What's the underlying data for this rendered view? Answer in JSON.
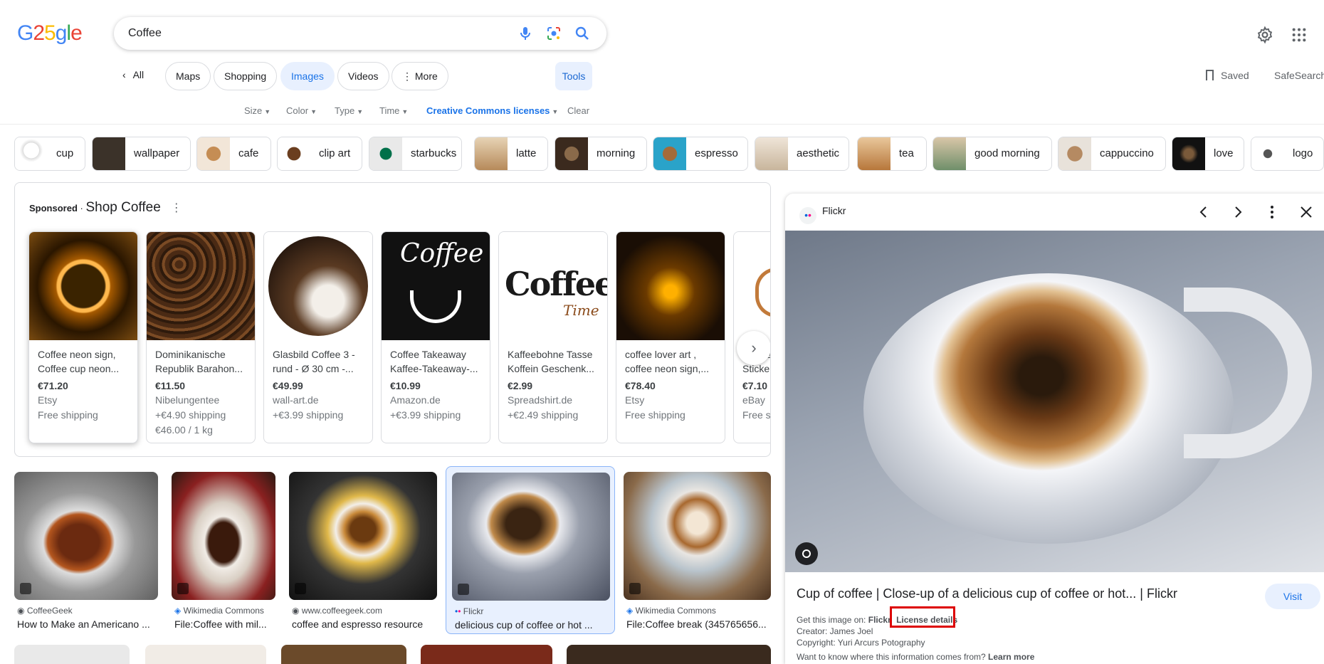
{
  "logo": {
    "text": "G25gle"
  },
  "search": {
    "query": "Coffee",
    "mic_icon": "mic-icon",
    "lens_icon": "lens-icon",
    "search_icon": "search-icon"
  },
  "header": {
    "settings_icon": "gear-icon",
    "apps_icon": "apps-grid-icon"
  },
  "nav": {
    "back": "All",
    "tabs": [
      "Maps",
      "Shopping",
      "Images",
      "Videos",
      "More"
    ],
    "active": "Images",
    "tools": "Tools",
    "saved": "Saved",
    "safesearch": "SafeSearch"
  },
  "filters": {
    "size": "Size",
    "color": "Color",
    "type": "Type",
    "time": "Time",
    "license": "Creative Commons licenses",
    "clear": "Clear"
  },
  "related": [
    "cup",
    "wallpaper",
    "cafe",
    "clip art",
    "starbucks",
    "latte",
    "morning",
    "espresso",
    "aesthetic",
    "tea",
    "good morning",
    "cappuccino",
    "love",
    "logo"
  ],
  "shop": {
    "sponsored": "Sponsored",
    "title": "Shop Coffee",
    "cards": [
      {
        "title": "Coffee neon sign, Coffee cup neon...",
        "price": "€71.20",
        "store": "Etsy",
        "shipping": "Free shipping",
        "unit": ""
      },
      {
        "title": "Dominikanische Republik Barahon...",
        "price": "€11.50",
        "store": "Nibelungentee",
        "shipping": "+€4.90 shipping",
        "unit": "€46.00 / 1 kg"
      },
      {
        "title": "Glasbild Coffee 3 - rund - Ø 30 cm -...",
        "price": "€49.99",
        "store": "wall-art.de",
        "shipping": "+€3.99 shipping",
        "unit": ""
      },
      {
        "title": "Coffee Takeaway Kaffee-Takeaway-...",
        "price": "€10.99",
        "store": "Amazon.de",
        "shipping": "+€3.99 shipping",
        "unit": ""
      },
      {
        "title": "Kaffeebohne Tasse Koffein Geschenk...",
        "price": "€2.99",
        "store": "Spreadshirt.de",
        "shipping": "+€2.49 shipping",
        "unit": ""
      },
      {
        "title": "coffee lover art , coffee neon sign,...",
        "price": "€78.40",
        "store": "Etsy",
        "shipping": "Free shipping",
        "unit": ""
      },
      {
        "title": "Coffee Sticke...",
        "price": "€7.10",
        "store": "eBay",
        "shipping": "Free sh",
        "unit": ""
      }
    ],
    "card_texts": {
      "c3": "Coffee",
      "c4a": "Coffee",
      "c4b": "Time"
    }
  },
  "results": [
    {
      "source": "CoffeeGeek",
      "title": "How to Make an Americano ..."
    },
    {
      "source": "Wikimedia Commons",
      "title": "File:Coffee with mil..."
    },
    {
      "source": "www.coffeegeek.com",
      "title": "coffee and espresso resource"
    },
    {
      "source": "Flickr",
      "title": "delicious cup of coffee or hot ..."
    },
    {
      "source": "Wikimedia Commons",
      "title": "File:Coffee break (345765656..."
    }
  ],
  "panel": {
    "source": "Flickr",
    "title": "Cup of coffee | Close-up of a delicious cup of coffee or hot... | Flickr",
    "visit": "Visit",
    "get_label": "Get this image on:",
    "get_source": "Flickr",
    "license": "License details",
    "creator": "Creator: James Joel",
    "copyright": "Copyright: Yuri Arcurs Potography",
    "know": "Want to know where this information comes from?",
    "learn": "Learn more"
  },
  "colors": {
    "accent": "#1a73e8",
    "chip_active_bg": "#e8f0fe",
    "highlight_box": "#dd0000"
  }
}
